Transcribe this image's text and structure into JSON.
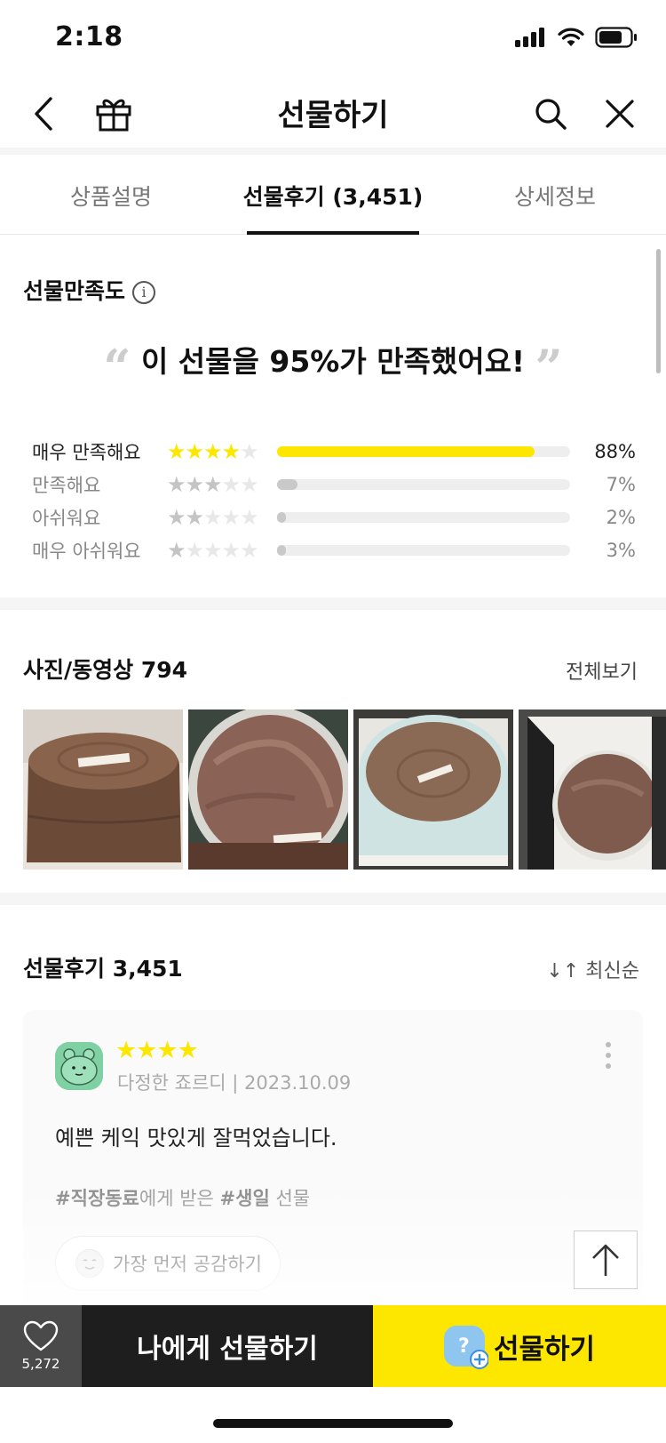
{
  "status_bar": {
    "time": "2:18"
  },
  "nav": {
    "title": "선물하기"
  },
  "tabs": [
    {
      "label": "상품설명",
      "active": false
    },
    {
      "label": "선물후기 (3,451)",
      "active": true
    },
    {
      "label": "상세정보",
      "active": false
    }
  ],
  "satisfaction": {
    "title": "선물만족도",
    "headline_prefix": "이 선물을 ",
    "headline_highlight": "95%가 만족했어요!",
    "ratings": [
      {
        "label": "매우 만족해요",
        "stars": 4,
        "percent_text": "88%",
        "percent": 88
      },
      {
        "label": "만족해요",
        "stars": 3,
        "percent_text": "7%",
        "percent": 7
      },
      {
        "label": "아쉬워요",
        "stars": 2,
        "percent_text": "2%",
        "percent": 2
      },
      {
        "label": "매우 아쉬워요",
        "stars": 1,
        "percent_text": "3%",
        "percent": 3
      }
    ]
  },
  "media": {
    "title": "사진/동영상 794",
    "see_all": "전체보기"
  },
  "reviews": {
    "title": "선물후기 3,451",
    "sort_label": "최신순",
    "items": [
      {
        "stars": "★★★★",
        "meta": "다정한 죠르디 | 2023.10.09",
        "text": "예쁜 케익 맛있게 잘먹었습니다.",
        "tag1": "#직장동료",
        "tag1_suffix": "에게 받은 ",
        "tag2": "#생일",
        "tag2_suffix": " 선물",
        "empathy": "가장 먼저 공감하기"
      }
    ]
  },
  "bottom": {
    "like_count": "5,272",
    "gift_me": "나에게 선물하기",
    "gift": "선물하기"
  },
  "colors": {
    "accent": "#fde600",
    "dark": "#1e1e1e"
  }
}
